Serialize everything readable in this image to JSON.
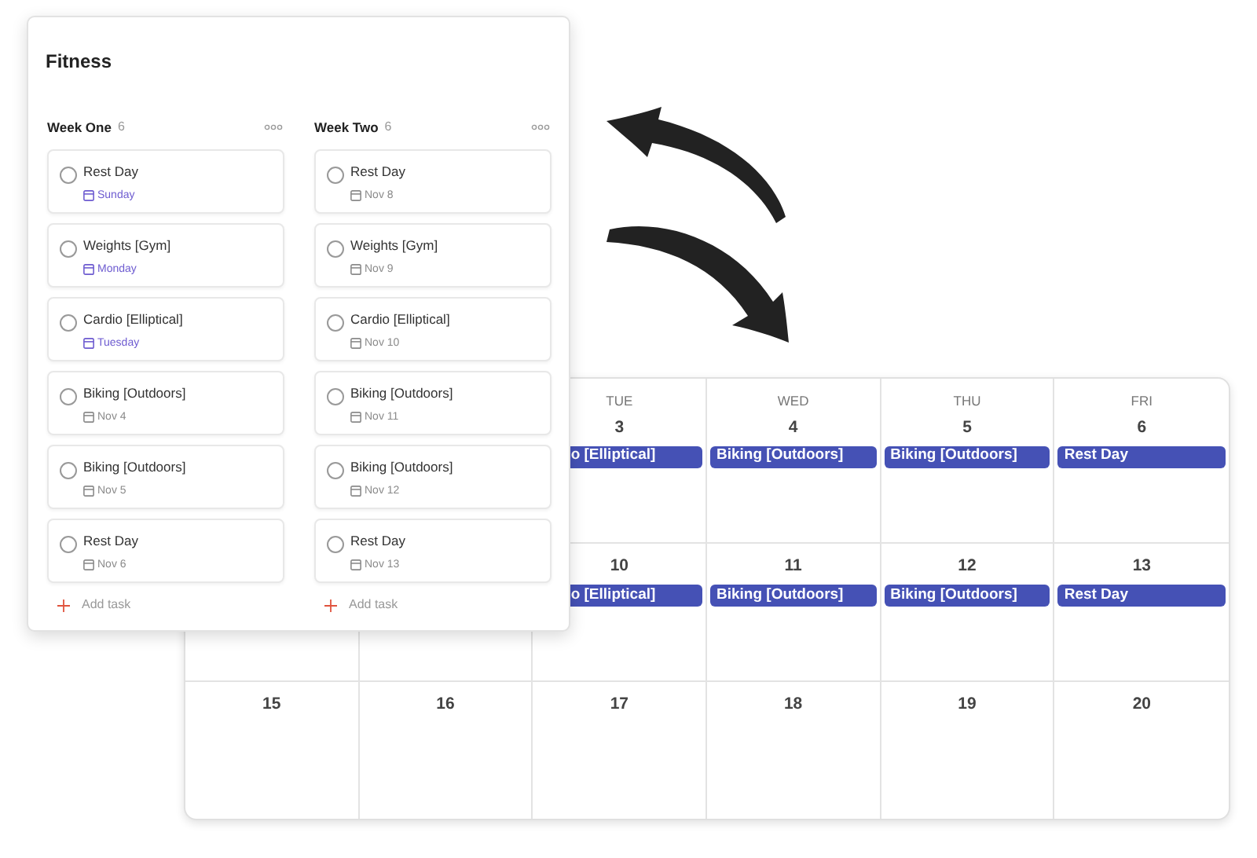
{
  "calendar": {
    "weeks": [
      {
        "cells": [
          {
            "day": "TUE",
            "date": "3",
            "events": [
              {
                "title": "o [Elliptical]",
                "kind": "continued"
              }
            ]
          },
          {
            "day": "WED",
            "date": "4",
            "events": [
              {
                "title": "Biking [Outdoors]",
                "kind": "full"
              }
            ]
          },
          {
            "day": "THU",
            "date": "5",
            "events": [
              {
                "title": "Biking [Outdoors]",
                "kind": "full"
              }
            ]
          },
          {
            "day": "FRI",
            "date": "6",
            "events": [
              {
                "title": "Rest Day",
                "kind": "full"
              }
            ]
          }
        ]
      },
      {
        "cells": [
          {},
          {},
          {
            "date": "10",
            "events": [
              {
                "title": "o [Elliptical]",
                "kind": "continued"
              }
            ]
          },
          {
            "date": "11",
            "events": [
              {
                "title": "Biking [Outdoors]",
                "kind": "full"
              }
            ]
          },
          {
            "date": "12",
            "events": [
              {
                "title": "Biking [Outdoors]",
                "kind": "full"
              }
            ]
          },
          {
            "date": "13",
            "events": [
              {
                "title": "Rest Day",
                "kind": "full"
              }
            ]
          }
        ]
      },
      {
        "cells": [
          {
            "date": "15"
          },
          {
            "date": "16"
          },
          {
            "date": "17"
          },
          {
            "date": "18"
          },
          {
            "date": "19"
          },
          {
            "date": "20"
          }
        ]
      }
    ]
  },
  "project": {
    "title": "Fitness",
    "sections": [
      {
        "name": "Week One",
        "count": "6",
        "add_label": "Add task",
        "tasks": [
          {
            "title": "Rest Day",
            "checked": false,
            "due": "Sunday",
            "color": "#6d5bd0"
          },
          {
            "title": "Weights [Gym]",
            "checked": false,
            "due": "Monday",
            "color": "#6d5bd0"
          },
          {
            "title": "Cardio [Elliptical]",
            "checked": false,
            "due": "Tuesday",
            "color": "#6d5bd0"
          },
          {
            "title": "Biking [Outdoors]",
            "checked": false,
            "due": "Nov 4",
            "color": "#8a8a8a"
          },
          {
            "title": "Biking [Outdoors]",
            "checked": false,
            "due": "Nov 5",
            "color": "#8a8a8a"
          },
          {
            "title": "Rest Day",
            "checked": false,
            "due": "Nov 6",
            "color": "#8a8a8a"
          }
        ]
      },
      {
        "name": "Week Two",
        "count": "6",
        "add_label": "Add task",
        "tasks": [
          {
            "title": "Rest Day",
            "checked": false,
            "due": "Nov 8",
            "color": "#8a8a8a"
          },
          {
            "title": "Weights [Gym]",
            "checked": false,
            "due": "Nov 9",
            "color": "#8a8a8a"
          },
          {
            "title": "Cardio [Elliptical]",
            "checked": false,
            "due": "Nov 10",
            "color": "#8a8a8a"
          },
          {
            "title": "Biking [Outdoors]",
            "checked": false,
            "due": "Nov 11",
            "color": "#8a8a8a"
          },
          {
            "title": "Biking [Outdoors]",
            "checked": false,
            "due": "Nov 12",
            "color": "#8a8a8a"
          },
          {
            "title": "Rest Day",
            "checked": false,
            "due": "Nov 13",
            "color": "#8a8a8a"
          }
        ]
      }
    ]
  }
}
